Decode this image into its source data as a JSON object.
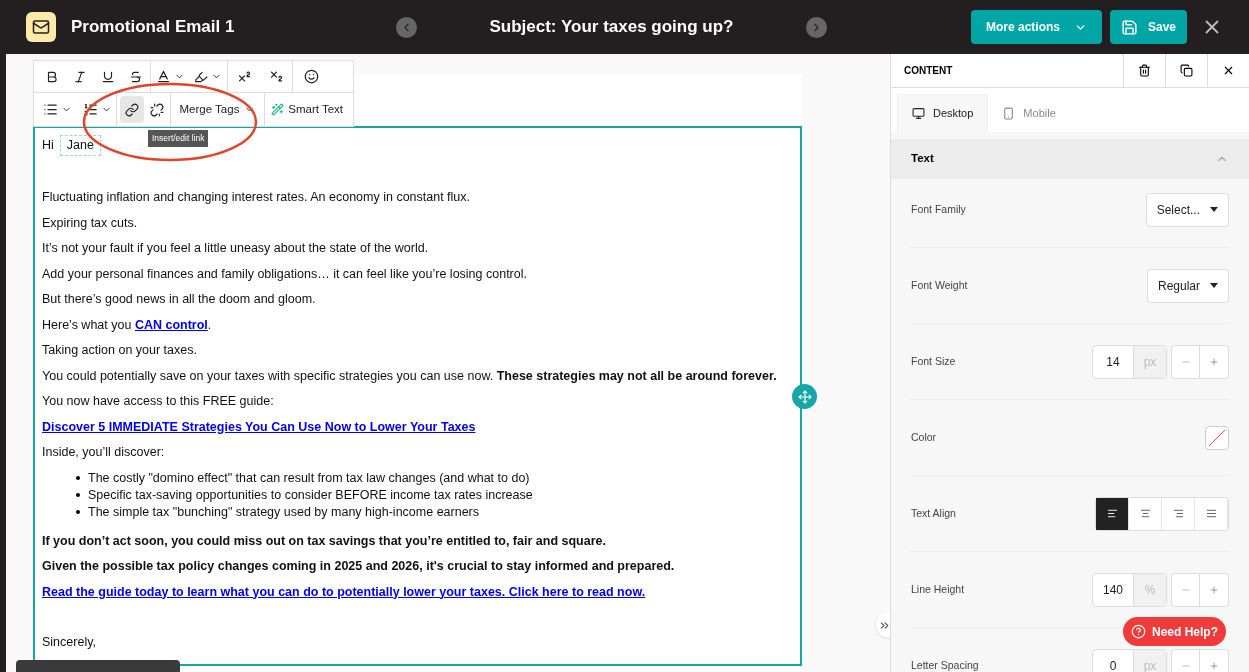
{
  "header": {
    "title": "Promotional Email 1",
    "subject": "Subject: Your taxes going up?",
    "more_actions": "More actions",
    "save": "Save"
  },
  "toolbar": {
    "link_active": true,
    "merge_tags": "Merge Tags",
    "smart_text": "Smart Text",
    "tooltip": "Insert/edit link"
  },
  "email": {
    "greeting": "Hi",
    "merge_tag": "Jane",
    "paragraphs": [
      {
        "kind": "blank"
      },
      {
        "kind": "text",
        "text": "Fluctuating inflation and changing interest rates. An economy in constant flux.",
        "bold": false
      },
      {
        "kind": "text",
        "text": "Expiring tax cuts.",
        "bold": false
      },
      {
        "kind": "text",
        "text": "It’s not your fault if you feel a little uneasy about the state of the world.",
        "bold": false
      },
      {
        "kind": "text",
        "text": "Add your personal finances and family obligations… it can feel like you’re losing control.",
        "bold": false
      },
      {
        "kind": "text",
        "text": "But there’s good news in all the doom and gloom.",
        "bold": false
      },
      {
        "kind": "inline_link",
        "before": "Here’s what you ",
        "link": "CAN control",
        "after": "."
      },
      {
        "kind": "text",
        "text": "Taking action on your taxes.",
        "bold": false
      },
      {
        "kind": "text",
        "text": "You could potentially save on your taxes with specific strategies you can use now. **These strategies may not all be around forever.**",
        "bold": false
      },
      {
        "kind": "text",
        "text": "You now have access to this FREE guide:",
        "bold": false
      },
      {
        "kind": "link",
        "text": "Discover 5 IMMEDIATE Strategies You Can Use Now to Lower Your Taxes"
      },
      {
        "kind": "text",
        "text": "Inside, you’ll discover:",
        "bold": false
      },
      {
        "kind": "bullets",
        "items": [
          "The costly \"domino effect\" that can result from tax law changes (and what to do)",
          "Specific tax-saving opportunities to consider BEFORE income tax rates increase",
          "The simple tax \"bunching\" strategy used by many high-income earners"
        ]
      },
      {
        "kind": "text",
        "text": "If you don’t act soon, you could miss out on tax savings that you’re entitled to, fair and square.",
        "bold": true
      },
      {
        "kind": "text",
        "text": "Given the possible tax policy changes coming in 2025 and 2026, it's crucial to stay informed and prepared.",
        "bold": true
      },
      {
        "kind": "link",
        "text": "Read the guide today to learn what you can do to potentially lower your taxes. Click here to read now."
      },
      {
        "kind": "blank"
      },
      {
        "kind": "text",
        "text": "Sincerely,",
        "bold": false
      }
    ]
  },
  "panel": {
    "title": "CONTENT",
    "tabs": [
      {
        "label": "Desktop",
        "selected": true
      },
      {
        "label": "Mobile",
        "selected": false
      }
    ],
    "section": "Text",
    "expanded": true,
    "rows": [
      {
        "kind": "select",
        "label": "Font Family",
        "value": "Select..."
      },
      {
        "kind": "select",
        "label": "Font Weight",
        "value": "Regular"
      },
      {
        "kind": "number",
        "label": "Font Size",
        "value": "14",
        "unit": "px"
      },
      {
        "kind": "color",
        "label": "Color"
      },
      {
        "kind": "align",
        "label": "Text Align",
        "options": [
          {
            "selected": true
          },
          {
            "selected": false
          },
          {
            "selected": false
          },
          {
            "selected": false
          }
        ]
      },
      {
        "kind": "number",
        "label": "Line Height",
        "value": "140",
        "unit": "%"
      },
      {
        "kind": "number",
        "label": "Letter Spacing",
        "value": "0",
        "unit": "px"
      }
    ]
  },
  "help": "Need Help?"
}
